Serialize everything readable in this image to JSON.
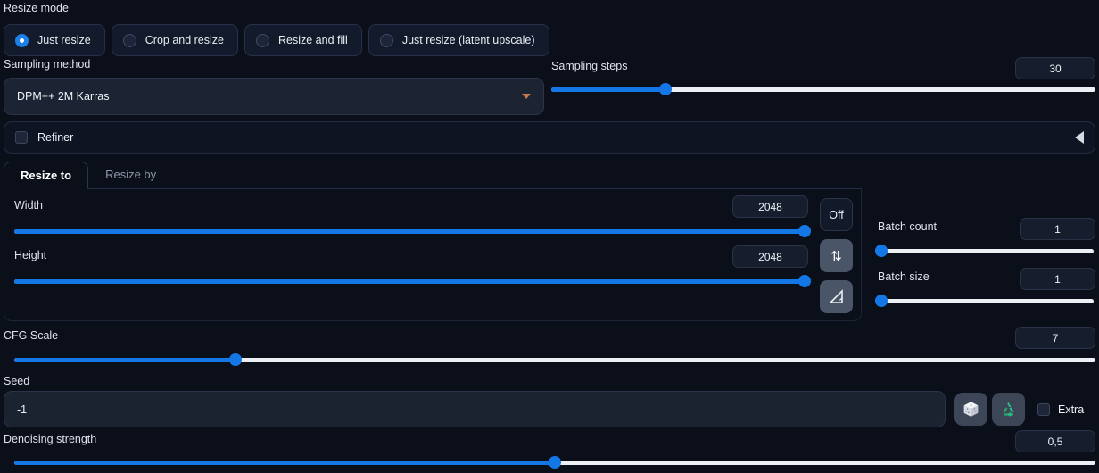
{
  "resize_mode": {
    "label": "Resize mode",
    "options": [
      {
        "label": "Just resize",
        "selected": true
      },
      {
        "label": "Crop and resize",
        "selected": false
      },
      {
        "label": "Resize and fill",
        "selected": false
      },
      {
        "label": "Just resize (latent upscale)",
        "selected": false
      }
    ]
  },
  "sampling_method": {
    "label": "Sampling method",
    "value": "DPM++ 2M Karras",
    "caret_icon": "chevron-down-icon"
  },
  "sampling_steps": {
    "label": "Sampling steps",
    "value": "30",
    "percent": 21
  },
  "refiner": {
    "label": "Refiner",
    "checked": false,
    "collapse_icon": "triangle-left-icon"
  },
  "resize_tabs": {
    "items": [
      {
        "label": "Resize to",
        "active": true
      },
      {
        "label": "Resize by",
        "active": false
      }
    ]
  },
  "dimensions": {
    "width": {
      "label": "Width",
      "value": "2048",
      "percent": 100
    },
    "height": {
      "label": "Height",
      "value": "2048",
      "percent": 100
    },
    "switch_mode_button": "Off",
    "swap_icon": "swap-vertical-icon",
    "aspect_ratio_icon": "triangle-ruler-icon"
  },
  "batch": {
    "count": {
      "label": "Batch count",
      "value": "1",
      "percent": 0
    },
    "size": {
      "label": "Batch size",
      "value": "1",
      "percent": 0
    }
  },
  "cfg_scale": {
    "label": "CFG Scale",
    "value": "7",
    "percent": 20.5
  },
  "seed": {
    "label": "Seed",
    "value": "-1",
    "placeholder": "-1",
    "random_icon": "dice-icon",
    "recycle_icon": "recycle-icon",
    "extra_label": "Extra",
    "extra_checked": false
  },
  "denoising": {
    "label": "Denoising strength",
    "value": "0,5",
    "percent": 50
  },
  "colors": {
    "accent_blue": "#1477e6",
    "recycle_green": "#2aa06a",
    "caret_orange": "#c8794a"
  }
}
